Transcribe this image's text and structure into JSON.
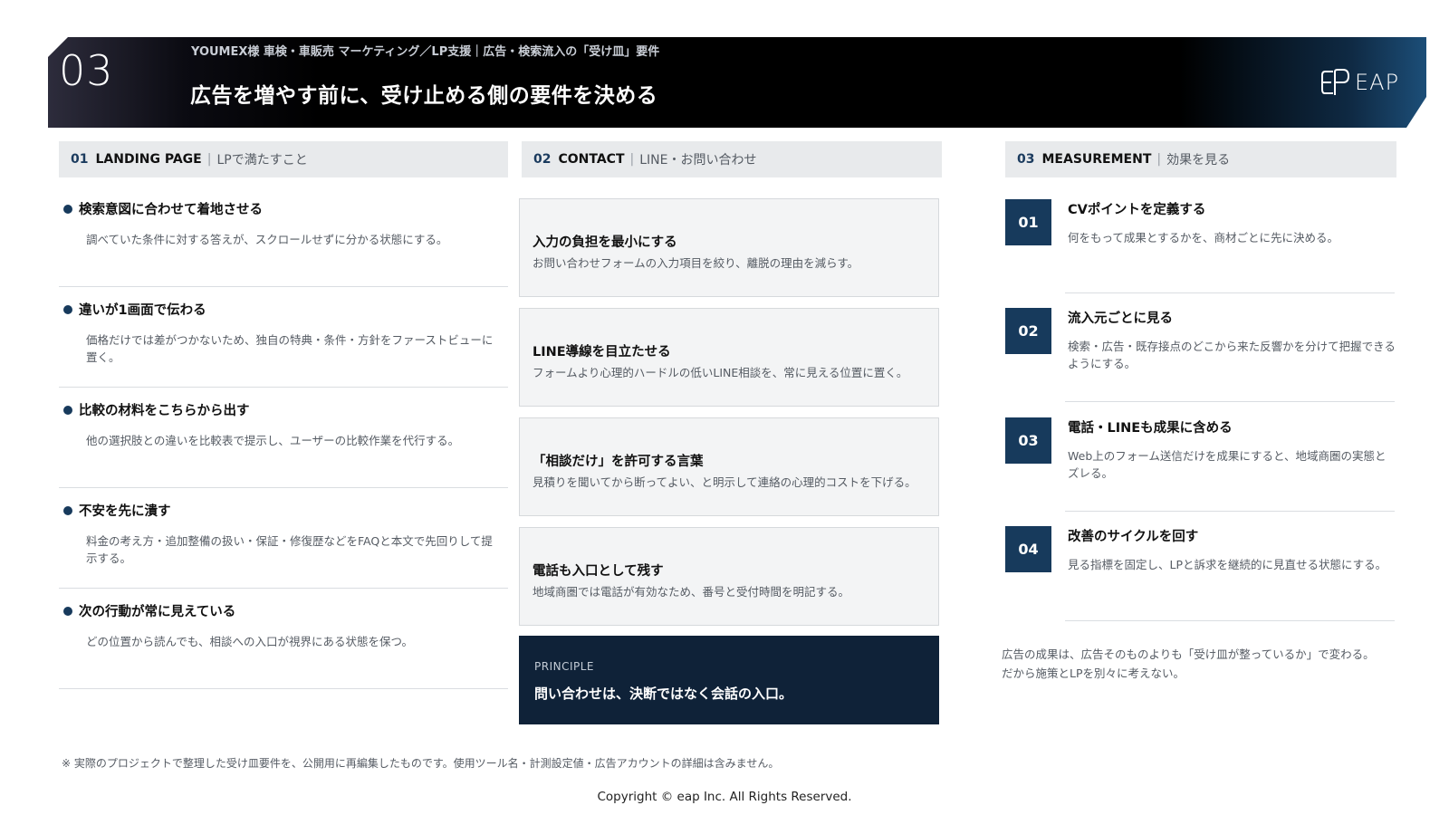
{
  "header": {
    "number": "03",
    "subtitle": "YOUMEX様 車検・車販売 マーケティング／LP支援｜広告・検索流入の「受け皿」要件",
    "title": "広告を増やす前に、受け止める側の要件を決める",
    "logo_text": "EAP"
  },
  "columns": [
    {
      "num": "01",
      "name": "LANDING PAGE",
      "sub": "LPで満たすこと",
      "items": [
        {
          "title": "検索意図に合わせて着地させる",
          "desc": "調べていた条件に対する答えが、スクロールせずに分かる状態にする。"
        },
        {
          "title": "違いが1画面で伝わる",
          "desc": "価格だけでは差がつかないため、独自の特典・条件・方針をファーストビューに置く。"
        },
        {
          "title": "比較の材料をこちらから出す",
          "desc": "他の選択肢との違いを比較表で提示し、ユーザーの比較作業を代行する。"
        },
        {
          "title": "不安を先に潰す",
          "desc": "料金の考え方・追加整備の扱い・保証・修復歴などをFAQと本文で先回りして提示する。"
        },
        {
          "title": "次の行動が常に見えている",
          "desc": "どの位置から読んでも、相談への入口が視界にある状態を保つ。"
        }
      ]
    },
    {
      "num": "02",
      "name": "CONTACT",
      "sub": "LINE・お問い合わせ",
      "items": [
        {
          "title": "入力の負担を最小にする",
          "desc": "お問い合わせフォームの入力項目を絞り、離脱の理由を減らす。"
        },
        {
          "title": "LINE導線を目立たせる",
          "desc": "フォームより心理的ハードルの低いLINE相談を、常に見える位置に置く。"
        },
        {
          "title": "「相談だけ」を許可する言葉",
          "desc": "見積りを聞いてから断ってよい、と明示して連絡の心理的コストを下げる。"
        },
        {
          "title": "電話も入口として残す",
          "desc": "地域商圏では電話が有効なため、番号と受付時間を明記する。"
        }
      ],
      "principle": {
        "label": "PRINCIPLE",
        "message": "問い合わせは、決断ではなく会話の入口。"
      }
    },
    {
      "num": "03",
      "name": "MEASUREMENT",
      "sub": "効果を見る",
      "items": [
        {
          "num": "01",
          "title": "CVポイントを定義する",
          "desc": "何をもって成果とするかを、商材ごとに先に決める。"
        },
        {
          "num": "02",
          "title": "流入元ごとに見る",
          "desc": "検索・広告・既存接点のどこから来た反響かを分けて把握できるようにする。"
        },
        {
          "num": "03",
          "title": "電話・LINEも成果に含める",
          "desc": "Web上のフォーム送信だけを成果にすると、地域商圏の実態とズレる。"
        },
        {
          "num": "04",
          "title": "改善のサイクルを回す",
          "desc": "見る指標を固定し、LPと訴求を継続的に見直せる状態にする。"
        }
      ],
      "note_line1": "広告の成果は、広告そのものよりも「受け皿が整っているか」で変わる。",
      "note_line2": "だから施策とLPを別々に考えない。"
    }
  ],
  "footnote": "※ 実際のプロジェクトで整理した受け皿要件を、公開用に再編集したものです。使用ツール名・計測設定値・広告アカウントの詳細は含みません。",
  "copyright": "Copyright © eap Inc. All Rights Reserved."
}
